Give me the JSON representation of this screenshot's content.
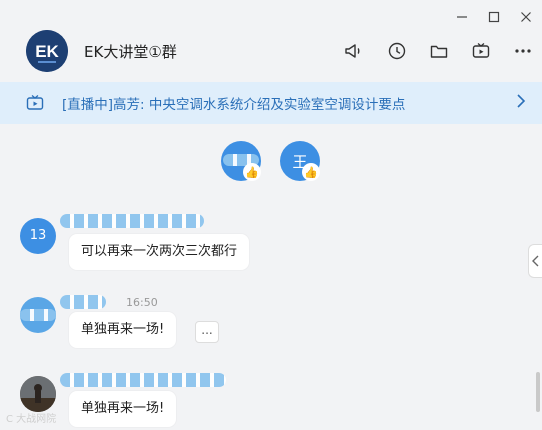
{
  "window": {
    "controls": [
      "minimize-icon",
      "maximize-icon",
      "close-icon"
    ]
  },
  "header": {
    "logo_text": "EK",
    "group_name": "EK大讲堂①群",
    "tools": [
      "announcement-icon",
      "history-icon",
      "folder-icon",
      "video-icon",
      "more-icon"
    ]
  },
  "live": {
    "text": "[直播中]高芳: 中央空调水系统介绍及实验室空调设计要点"
  },
  "reactions": [
    {
      "avatar_text": "",
      "emoji": "👍"
    },
    {
      "avatar_text": "王",
      "emoji": "👍"
    }
  ],
  "messages": [
    {
      "avatar_text": "13",
      "time": "",
      "text": "可以再来一次两次三次都行"
    },
    {
      "avatar_text": "",
      "time": "16:50",
      "text": "单独再来一场!",
      "more_label": "..."
    },
    {
      "avatar_text": "",
      "time": "",
      "text": "单独再来一场!"
    }
  ],
  "watermark": "C 大战网院"
}
